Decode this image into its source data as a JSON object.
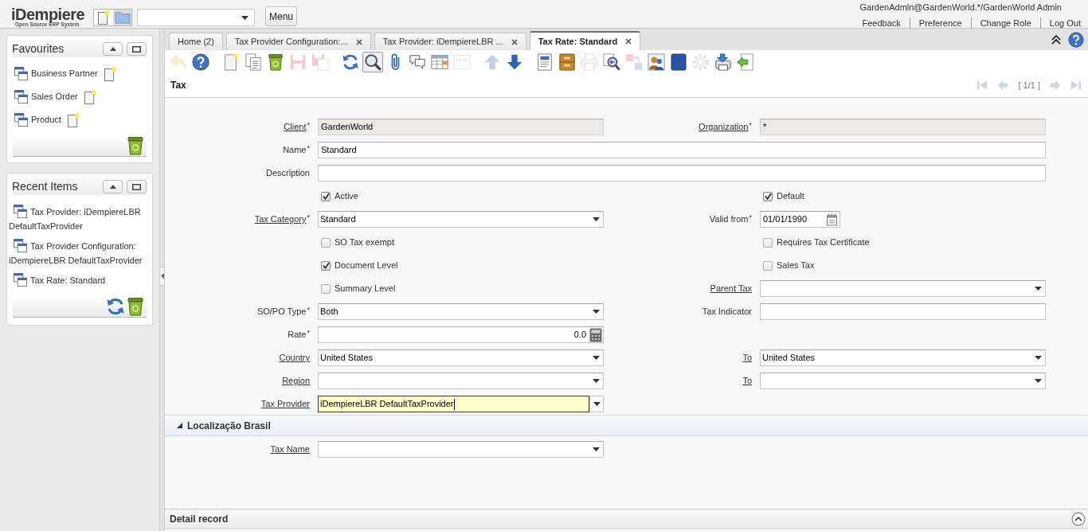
{
  "header": {
    "logo": {
      "name": "iDempiere",
      "tagline": "Open Source ERP System"
    },
    "menu_button": "Menu",
    "user": "GardenAdmin@GardenWorld.*/GardenWorld Admin",
    "links": [
      "Feedback",
      "Preference",
      "Change Role",
      "Log Out"
    ]
  },
  "sidebar": [
    {
      "kind": "favourites",
      "title": "Favourites",
      "items": [
        "Business Partner",
        "Sales Order",
        "Product"
      ]
    },
    {
      "kind": "recent",
      "title": "Recent Items",
      "items": [
        "Tax Provider: iDempiereLBR DefaultTaxProvider",
        "Tax Provider Configuration: iDempiereLBR DefaultTaxProvider",
        "Tax Rate: Standard"
      ]
    }
  ],
  "tabs": [
    {
      "label": "Home (2)",
      "selected": false,
      "closable": false
    },
    {
      "label": "Tax Provider Configuration:...",
      "selected": false,
      "closable": true
    },
    {
      "label": "Tax Provider: iDempiereLBR ...",
      "selected": false,
      "closable": true
    },
    {
      "label": "Tax Rate: Standard",
      "selected": true,
      "closable": true
    }
  ],
  "toolbar": [
    [
      {
        "kind": "undo",
        "disabled": true,
        "pressed": false
      },
      {
        "kind": "help",
        "disabled": false,
        "pressed": false
      }
    ],
    [
      {
        "kind": "new",
        "disabled": false,
        "pressed": false
      },
      {
        "kind": "copy",
        "disabled": false,
        "pressed": false
      },
      {
        "kind": "delete",
        "disabled": false,
        "pressed": false
      },
      {
        "kind": "save",
        "disabled": true,
        "pressed": false
      },
      {
        "kind": "savenew",
        "disabled": true,
        "pressed": false
      }
    ],
    [
      {
        "kind": "refresh",
        "disabled": false,
        "pressed": false
      },
      {
        "kind": "find",
        "disabled": false,
        "pressed": true
      },
      {
        "kind": "attach",
        "disabled": false,
        "pressed": false
      },
      {
        "kind": "chat",
        "disabled": false,
        "pressed": false
      },
      {
        "kind": "grid",
        "disabled": false,
        "pressed": false
      },
      {
        "kind": "multi",
        "disabled": true,
        "pressed": false
      }
    ],
    [
      {
        "kind": "up",
        "disabled": true,
        "pressed": false
      },
      {
        "kind": "down",
        "disabled": false,
        "pressed": false
      }
    ],
    [
      {
        "kind": "report",
        "disabled": false,
        "pressed": false
      },
      {
        "kind": "archive",
        "disabled": false,
        "pressed": false
      },
      {
        "kind": "print",
        "disabled": true,
        "pressed": false
      },
      {
        "kind": "zoom",
        "disabled": false,
        "pressed": false
      },
      {
        "kind": "request",
        "disabled": true,
        "pressed": false
      },
      {
        "kind": "info",
        "disabled": false,
        "pressed": false
      },
      {
        "kind": "workflow",
        "disabled": false,
        "pressed": false
      },
      {
        "kind": "process",
        "disabled": true,
        "pressed": false
      },
      {
        "kind": "export",
        "disabled": false,
        "pressed": false
      },
      {
        "kind": "import",
        "disabled": false,
        "pressed": false
      }
    ]
  ],
  "record": {
    "title": "Tax",
    "navigation": [
      {
        "kind": "first",
        "disabled": true
      },
      {
        "kind": "previous",
        "disabled": true
      },
      {
        "kind": "position",
        "text": "[ 1/1 ]"
      },
      {
        "kind": "next",
        "disabled": true
      },
      {
        "kind": "last",
        "disabled": true
      }
    ]
  },
  "form": {
    "rows": [
      {
        "kind": "pair",
        "left": {
          "kind": "text",
          "label": "Client",
          "link": true,
          "required_mark": "*",
          "value": "GardenWorld",
          "readonly": true,
          "focused": false
        },
        "right": {
          "kind": "text",
          "label": "Organization",
          "link": true,
          "required_mark": "*",
          "value": "*",
          "readonly": true,
          "focused": false
        }
      },
      {
        "kind": "wide",
        "field": {
          "kind": "text",
          "label": "Name",
          "link": false,
          "required_mark": "*",
          "value": "Standard",
          "readonly": false,
          "focused": false
        }
      },
      {
        "kind": "wide",
        "field": {
          "kind": "text",
          "label": "Description",
          "link": false,
          "readonly": false,
          "focused": false
        }
      },
      {
        "kind": "pair",
        "left": {
          "kind": "checkbox",
          "label": "Active",
          "checked": true
        },
        "right": {
          "kind": "checkbox",
          "label": "Default",
          "checked": true
        }
      },
      {
        "kind": "pair",
        "left": {
          "kind": "select",
          "label": "Tax Category",
          "link": true,
          "required_mark": "*",
          "value": "Standard",
          "readonly": false,
          "focused": false
        },
        "right": {
          "kind": "date",
          "label": "Valid from",
          "link": false,
          "required_mark": "*",
          "value": "01/01/1990",
          "readonly": false,
          "focused": false
        }
      },
      {
        "kind": "pair",
        "left": {
          "kind": "checkbox",
          "label": "SO Tax exempt",
          "checked": false
        },
        "right": {
          "kind": "checkbox",
          "label": "Requires Tax Certificate",
          "checked": false
        }
      },
      {
        "kind": "pair",
        "left": {
          "kind": "checkbox",
          "label": "Document Level",
          "checked": true
        },
        "right": {
          "kind": "checkbox",
          "label": "Sales Tax",
          "checked": false
        }
      },
      {
        "kind": "pair",
        "left": {
          "kind": "checkbox",
          "label": "Summary Level",
          "checked": false
        },
        "right": {
          "kind": "select",
          "label": "Parent Tax",
          "link": true,
          "readonly": false,
          "focused": false
        }
      },
      {
        "kind": "pair",
        "left": {
          "kind": "select",
          "label": "SO/PO Type",
          "link": false,
          "required_mark": "*",
          "value": "Both",
          "readonly": false,
          "focused": false
        },
        "right": {
          "kind": "text",
          "label": "Tax Indicator",
          "link": false,
          "readonly": false,
          "focused": false
        }
      },
      {
        "kind": "pair",
        "left": {
          "kind": "number",
          "label": "Rate",
          "link": false,
          "required_mark": "*",
          "value": "0.0",
          "readonly": false,
          "focused": false
        }
      },
      {
        "kind": "pair",
        "left": {
          "kind": "select",
          "label": "Country",
          "link": true,
          "value": "United States",
          "readonly": false,
          "focused": false
        },
        "right": {
          "kind": "select",
          "label": "To",
          "link": true,
          "value": "United States",
          "readonly": false,
          "focused": false
        }
      },
      {
        "kind": "pair",
        "left": {
          "kind": "select",
          "label": "Region",
          "link": true,
          "readonly": false,
          "focused": false
        },
        "right": {
          "kind": "select",
          "label": "To",
          "link": true,
          "readonly": false,
          "focused": false
        }
      },
      {
        "kind": "pair",
        "left": {
          "kind": "select",
          "label": "Tax Provider",
          "link": true,
          "value": "iDempiereLBR DefaultTaxProvider",
          "readonly": false,
          "focused": true
        }
      }
    ]
  },
  "sections": [
    {
      "title": "Localização Brasil",
      "expanded": true,
      "rows": [
        {
          "kind": "pair",
          "left": {
            "kind": "select",
            "label": "Tax Name",
            "link": true,
            "readonly": false,
            "focused": false
          }
        }
      ]
    }
  ],
  "detail": {
    "title": "Detail record"
  }
}
